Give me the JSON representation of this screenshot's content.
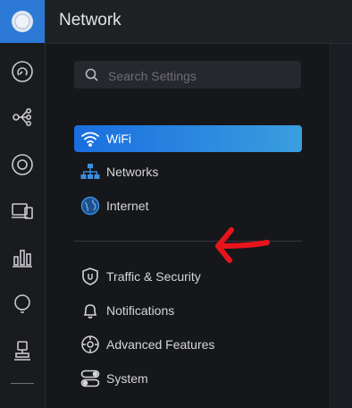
{
  "header": {
    "title": "Network"
  },
  "search": {
    "placeholder": "Search Settings",
    "value": ""
  },
  "nav_primary": [
    {
      "label": "WiFi",
      "icon": "wifi-icon",
      "active": true
    },
    {
      "label": "Networks",
      "icon": "networks-icon",
      "active": false
    },
    {
      "label": "Internet",
      "icon": "globe-icon",
      "active": false
    }
  ],
  "nav_secondary": [
    {
      "label": "Traffic & Security",
      "icon": "shield-icon"
    },
    {
      "label": "Notifications",
      "icon": "bell-icon"
    },
    {
      "label": "Advanced Features",
      "icon": "advanced-icon"
    },
    {
      "label": "System",
      "icon": "toggles-icon"
    }
  ],
  "rail_icons": [
    "dashboard-icon",
    "topology-icon",
    "devices-icon",
    "clients-icon",
    "statistics-icon",
    "insights-icon",
    "alarm-icon"
  ],
  "colors": {
    "accent": "#1a6ee0",
    "accent_end": "#3a9ede",
    "annotation_arrow": "#e8141b"
  }
}
